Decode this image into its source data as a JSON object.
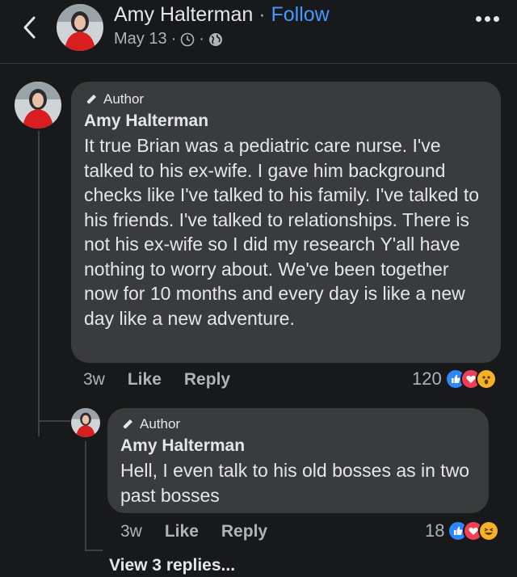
{
  "header": {
    "name": "Amy Halterman",
    "separator": "·",
    "follow_label": "Follow",
    "date": "May 13",
    "meta_sep": "·",
    "meta_sep2": "·",
    "icons": [
      "back-chevron-icon",
      "clock-icon",
      "globe-icon",
      "more-dots-icon"
    ]
  },
  "comments": [
    {
      "badge": "Author",
      "name": "Amy Halterman",
      "text": "It true Brian was a pediatric care nurse. I've talked to his ex-wife. I gave him background checks like I've talked to his family. I've talked to his friends. I've talked to relationships. There is not his ex-wife so I did my research Y'all have nothing to worry about. We've been together now for 10 months and every day is like a new day like a new adventure.",
      "time": "3w",
      "like_label": "Like",
      "reply_label": "Reply",
      "reaction_count": "120",
      "reactions": [
        "like",
        "love",
        "wow"
      ]
    },
    {
      "badge": "Author",
      "name": "Amy Halterman",
      "text": "Hell, I even talk to his old bosses as in two past bosses",
      "time": "3w",
      "like_label": "Like",
      "reply_label": "Reply",
      "reaction_count": "18",
      "reactions": [
        "like",
        "love",
        "haha"
      ]
    }
  ],
  "view_replies_label": "View 3 replies...",
  "colors": {
    "background": "#18191a",
    "bubble": "#3a3b3c",
    "link": "#4599ff",
    "secondary_text": "#b0b3b8",
    "like": "#2d88ff",
    "love": "#f33e58",
    "wow": "#f7b125"
  }
}
